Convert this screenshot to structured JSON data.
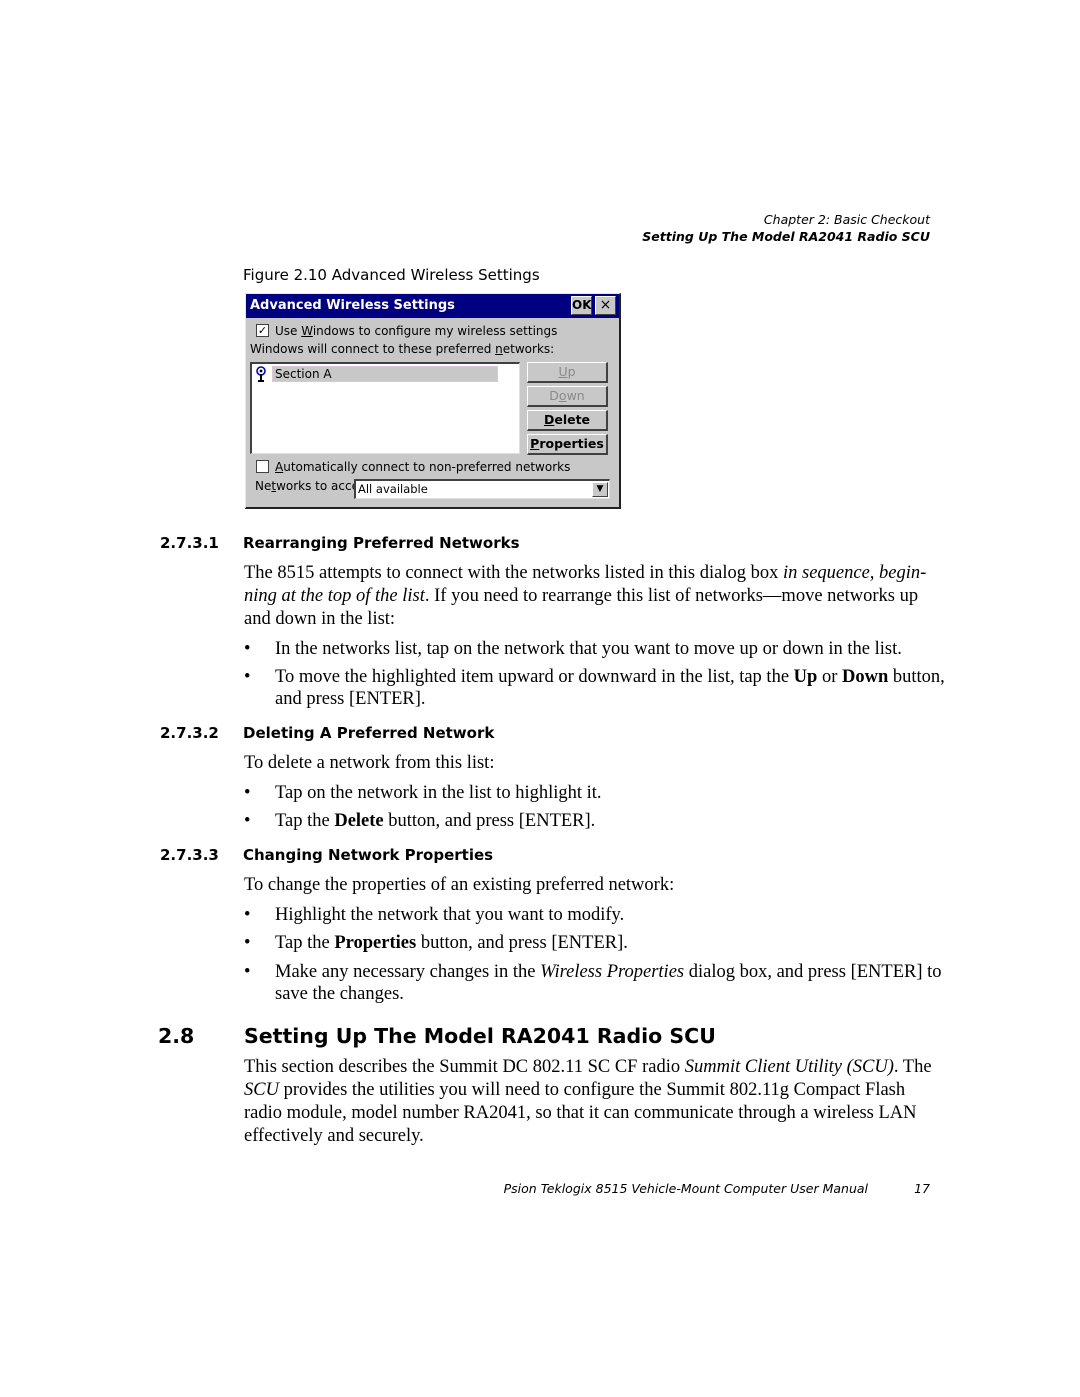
{
  "running_head": {
    "chapter": "Chapter 2: Basic Checkout",
    "section": "Setting Up The Model RA2041 Radio SCU"
  },
  "figure": {
    "caption": "Figure 2.10 Advanced Wireless Settings",
    "dialog": {
      "title": "Advanced Wireless Settings",
      "ok_label": "OK",
      "close_label": "×",
      "use_windows_checkbox": {
        "checked": true,
        "mark": "✓",
        "label_pre": "Use ",
        "label_ul": "W",
        "label_post": "indows to configure my wireless settings"
      },
      "preferred_label": {
        "pre": "Windows will connect to these preferred ",
        "ul": "n",
        "post": "etworks:"
      },
      "networks": [
        {
          "name": "Section A",
          "icon": "wireless-ap-icon",
          "selected": true
        }
      ],
      "buttons": [
        {
          "pre": "",
          "ul": "U",
          "post": "p",
          "disabled": true
        },
        {
          "pre": "D",
          "ul": "o",
          "post": "wn",
          "disabled": true
        },
        {
          "pre": "",
          "ul": "D",
          "post": "elete",
          "disabled": false
        },
        {
          "pre": "",
          "ul": "P",
          "post": "roperties",
          "disabled": false
        }
      ],
      "auto_connect_checkbox": {
        "checked": false,
        "label_pre": "",
        "label_ul": "A",
        "label_post": "utomatically connect to non-preferred networks"
      },
      "networks_to_access": {
        "label_pre": "Ne",
        "label_ul": "t",
        "label_post": "works to access:",
        "value": "All available",
        "arrow": "▼"
      }
    }
  },
  "sections": {
    "s1": {
      "number": "2.7.3.1",
      "title": "Rearranging Preferred Networks",
      "para": {
        "a": "The 8515 attempts to connect with the networks listed in this dialog box ",
        "b_italic": "in sequence, begin-ning at the top of the list",
        "c": ". If you need to rearrange this list of networks—move networks up and down in the list:"
      },
      "bullets": [
        {
          "text": "In the networks list, tap on the network that you want to move up or down in the list."
        },
        {
          "pre": "To move the highlighted item upward or downward in the list, tap the ",
          "b1": "Up",
          "mid": " or ",
          "b2": "Down",
          "post": " button, and press [ENTER]."
        }
      ]
    },
    "s2": {
      "number": "2.7.3.2",
      "title": "Deleting A Preferred Network",
      "intro": "To delete a network from this list:",
      "bullets": [
        {
          "text": "Tap on the network in the list to highlight it."
        },
        {
          "pre": "Tap the ",
          "bold": "Delete",
          "post": " button, and press [ENTER]."
        }
      ]
    },
    "s3": {
      "number": "2.7.3.3",
      "title": "Changing Network Properties",
      "intro": "To change the properties of an existing preferred network:",
      "bullets": [
        {
          "text": "Highlight the network that you want to modify."
        },
        {
          "pre": "Tap the ",
          "bold": "Properties",
          "post": " button, and press [ENTER]."
        },
        {
          "pre": "Make any necessary changes in the ",
          "italic": "Wireless Properties",
          "post": " dialog box, and press [ENTER] to save the changes."
        }
      ]
    },
    "s4": {
      "number": "2.8",
      "title": "Setting Up The Model RA2041 Radio SCU",
      "para": {
        "a": "This section describes the Summit DC 802.11 SC CF radio ",
        "b_italic": "Summit Client Utility (SCU)",
        "c": ". The ",
        "d_italic": "SCU",
        "e": " provides the utilities you will need to configure the Summit 802.11g Compact Flash radio module, model number RA2041, so that it can communicate through a wireless LAN effectively and securely."
      }
    }
  },
  "footer": {
    "title": "Psion Teklogix 8515 Vehicle-Mount Computer User Manual",
    "page": "17"
  },
  "bullet_glyph": "•"
}
